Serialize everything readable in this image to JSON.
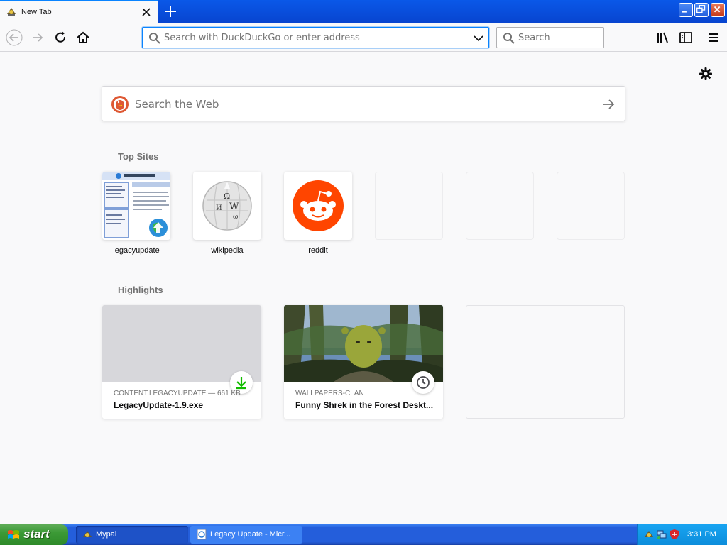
{
  "tab": {
    "title": "New Tab"
  },
  "navbar": {
    "url_placeholder": "Search with DuckDuckGo or enter address",
    "search_placeholder": "Search"
  },
  "newtab": {
    "websearch_placeholder": "Search the Web",
    "top_sites_title": "Top Sites",
    "highlights_title": "Highlights",
    "top_sites": [
      {
        "label": "legacyupdate"
      },
      {
        "label": "wikipedia"
      },
      {
        "label": "reddit"
      }
    ],
    "highlights": [
      {
        "meta": "CONTENT.LEGACYUPDATE — 661 KB",
        "name": "LegacyUpdate-1.9.exe",
        "badge": "download-icon"
      },
      {
        "meta": "WALLPAPERS-CLAN",
        "name": "Funny Shrek in the Forest Deskt...",
        "badge": "clock-icon"
      }
    ]
  },
  "taskbar": {
    "start_label": "start",
    "tasks": [
      {
        "label": "Mypal"
      },
      {
        "label": "Legacy Update - Micr..."
      }
    ],
    "clock": "3:31 PM"
  },
  "colors": {
    "accent": "#0a84ff",
    "reddit": "#ff4500",
    "xp_blue": "#245edb",
    "xp_green": "#3c9a36"
  }
}
